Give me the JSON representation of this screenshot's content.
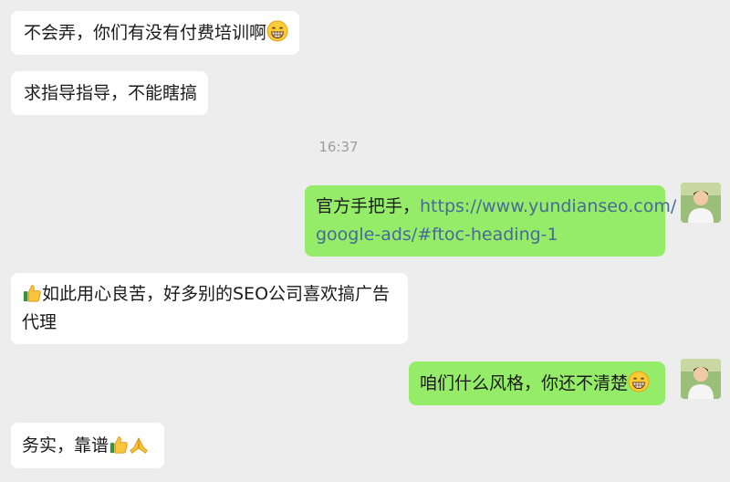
{
  "messages": [
    {
      "side": "left",
      "text": "不会弄，你们有没有付费培训啊",
      "emoji": "grinning-face"
    },
    {
      "side": "left",
      "text": "求指导指导，不能瞎搞"
    },
    {
      "timestamp": "16:37"
    },
    {
      "side": "right",
      "prefix": "官方手把手，",
      "link_line1": "https://www.yundianseo.com/",
      "link_line2": "google-ads/#ftoc-heading-1"
    },
    {
      "side": "left",
      "line1": "如此用心良苦，好多别的SEO公司喜欢搞广告",
      "line2": "代理",
      "emoji": "thumbs-up"
    },
    {
      "side": "right",
      "text": "咱们什么风格，你还不清楚",
      "emoji": "grinning-face"
    },
    {
      "side": "left",
      "text": "务实，靠谱",
      "emojis": [
        "thumbs-up",
        "folded-hands"
      ]
    }
  ],
  "colors": {
    "background": "#ededed",
    "incoming_bubble": "#ffffff",
    "outgoing_bubble": "#95ec69",
    "link": "#486a96",
    "timestamp": "#9c9c9c"
  }
}
